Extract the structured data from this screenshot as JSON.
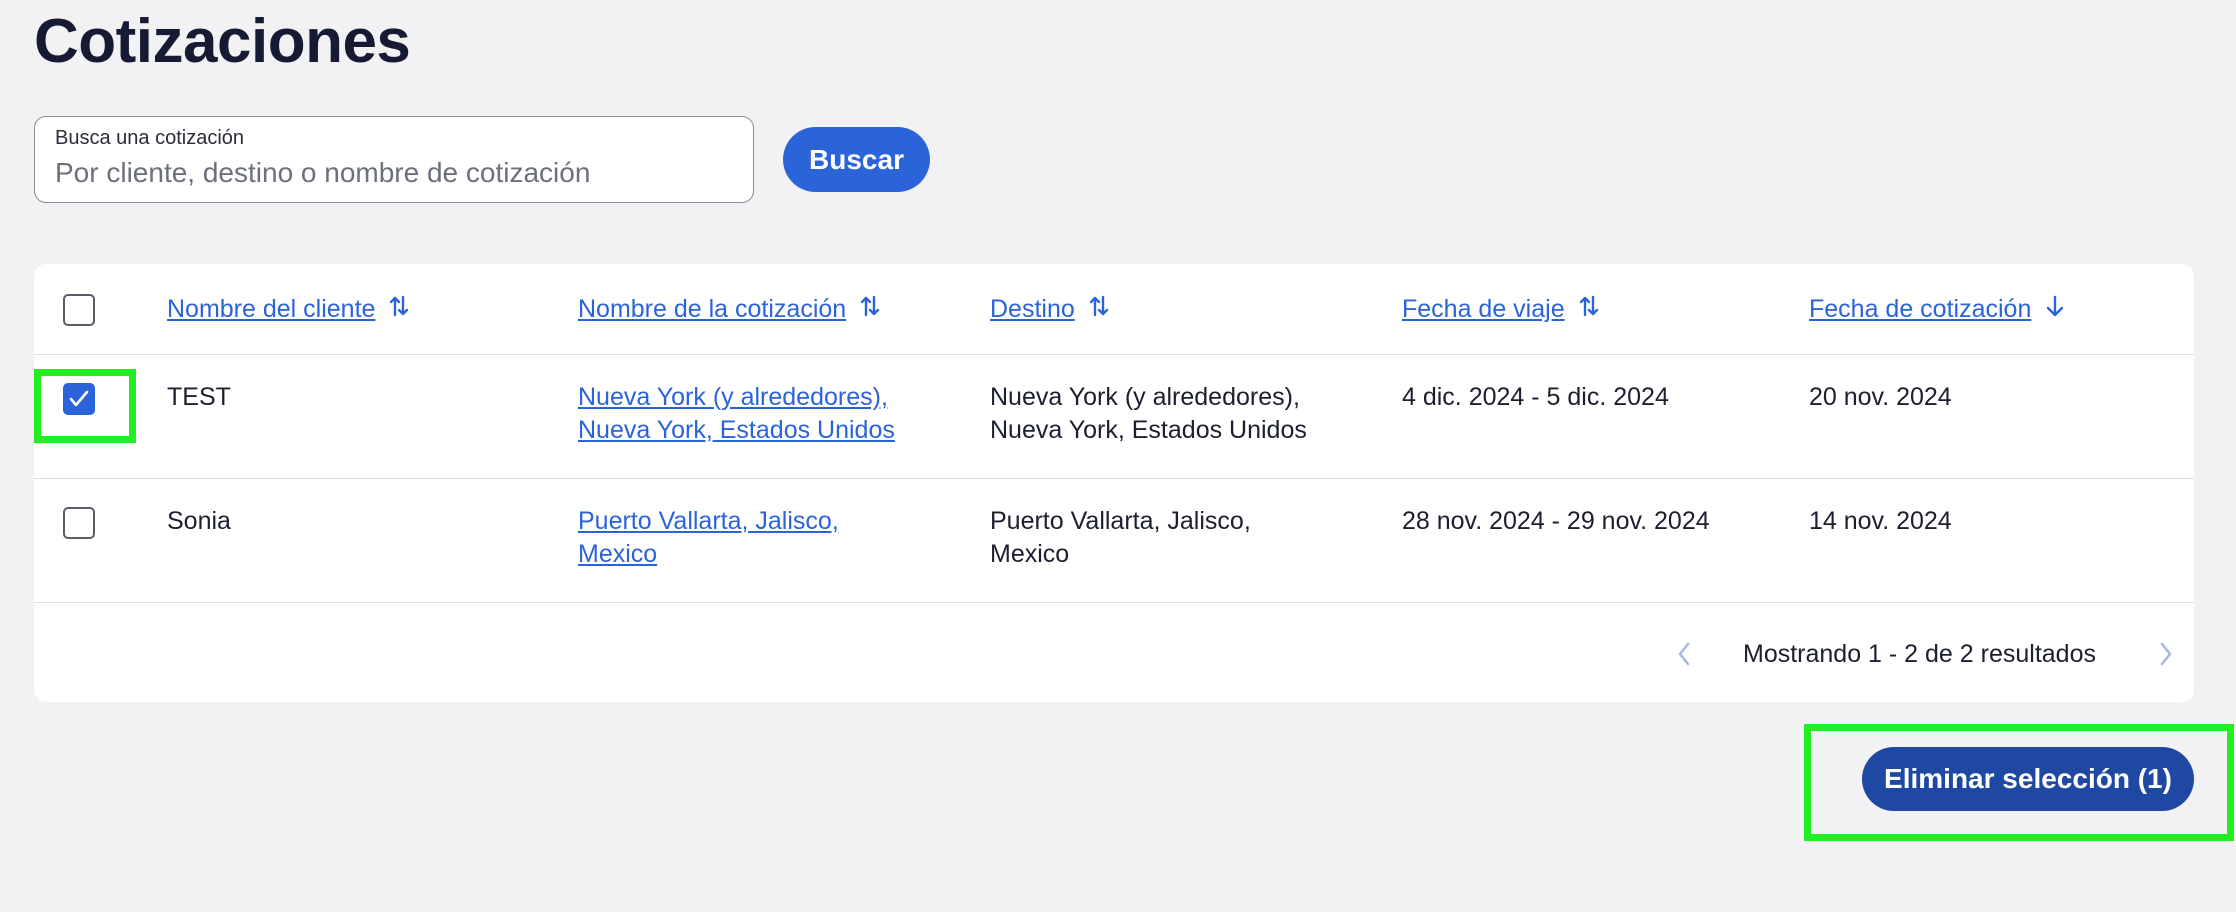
{
  "page": {
    "title": "Cotizaciones"
  },
  "search": {
    "label": "Busca una cotización",
    "placeholder": "Por cliente, destino o nombre de cotización",
    "value": "",
    "button_label": "Buscar"
  },
  "table": {
    "columns": [
      {
        "label": "Nombre del cliente",
        "sort_icon": "sort-both-icon"
      },
      {
        "label": "Nombre de la cotización",
        "sort_icon": "sort-both-icon"
      },
      {
        "label": "Destino",
        "sort_icon": "sort-both-icon"
      },
      {
        "label": "Fecha de viaje",
        "sort_icon": "sort-both-icon"
      },
      {
        "label": "Fecha de cotización",
        "sort_icon": "arrow-down-icon"
      }
    ],
    "rows": [
      {
        "selected": true,
        "client": "TEST",
        "quote_line1": "Nueva York (y alrededores),",
        "quote_line2": "Nueva York, Estados Unidos",
        "dest_line1": "Nueva York (y alrededores),",
        "dest_line2": "Nueva York, Estados Unidos",
        "travel_dates": "4 dic. 2024 - 5 dic. 2024",
        "quote_date": "20 nov. 2024"
      },
      {
        "selected": false,
        "client": "Sonia",
        "quote_line1": "Puerto Vallarta, Jalisco,",
        "quote_line2": "Mexico",
        "dest_line1": "Puerto Vallarta, Jalisco,",
        "dest_line2": "Mexico",
        "travel_dates": "28 nov. 2024 - 29 nov. 2024",
        "quote_date": "14 nov. 2024"
      }
    ]
  },
  "pagination": {
    "text": "Mostrando 1 - 2 de 2 resultados"
  },
  "actions": {
    "delete_label": "Eliminar selección (1)"
  },
  "colors": {
    "accent": "#2b63d9",
    "delete_button": "#1f48a3",
    "highlight": "#22ee22",
    "background": "#f2f2f4"
  }
}
